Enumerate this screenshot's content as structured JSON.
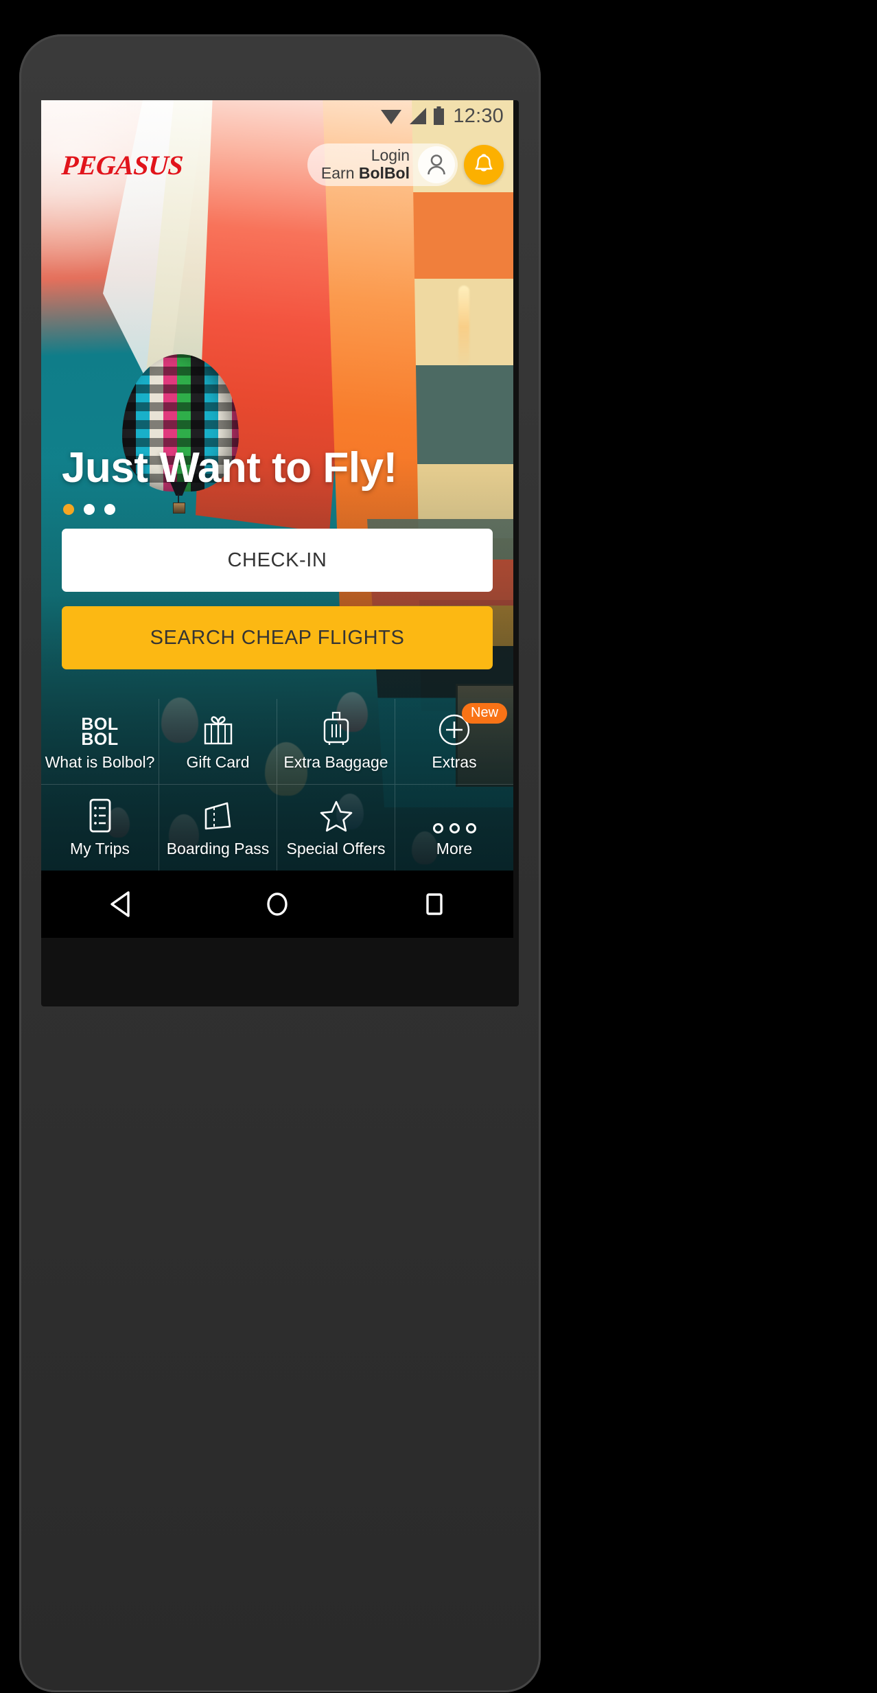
{
  "status_bar": {
    "time": "12:30",
    "icons": [
      "wifi-icon",
      "signal-icon",
      "battery-icon"
    ]
  },
  "header": {
    "brand": "PEGASUS",
    "brand_color": "#e1141b",
    "login_label": "Login",
    "earn_prefix": "Earn ",
    "earn_program": "BolBol",
    "avatar_icon": "user-icon",
    "bell_icon": "bell-icon",
    "bell_color": "#fcb000"
  },
  "hero": {
    "headline": "Just Want to Fly!",
    "dots_total": 3,
    "active_dot_index": 0,
    "active_dot_color": "#f5a623",
    "inactive_dot_color": "#ffffff"
  },
  "actions": {
    "checkin_label": "CHECK-IN",
    "checkin_bg": "#ffffff",
    "search_label": "SEARCH CHEAP FLIGHTS",
    "search_bg": "#fcb813"
  },
  "menu": {
    "items": [
      {
        "label": "What is Bolbol?",
        "icon": "bolbol-logo-icon",
        "badge": null
      },
      {
        "label": "Gift Card",
        "icon": "gift-icon",
        "badge": null
      },
      {
        "label": "Extra Baggage",
        "icon": "suitcase-icon",
        "badge": null
      },
      {
        "label": "Extras",
        "icon": "plus-circle-icon",
        "badge": "New"
      },
      {
        "label": "My Trips",
        "icon": "list-icon",
        "badge": null
      },
      {
        "label": "Boarding Pass",
        "icon": "boarding-pass-icon",
        "badge": null
      },
      {
        "label": "Special Offers",
        "icon": "star-icon",
        "badge": null
      },
      {
        "label": "More",
        "icon": "three-dots-icon",
        "badge": null
      }
    ],
    "bolbol_line1": "BOL",
    "bolbol_line2": "BOL",
    "badge_color": "#f97316"
  },
  "nav_bar": {
    "back_icon": "back-triangle-icon",
    "home_icon": "home-circle-icon",
    "recents_icon": "recents-square-icon"
  }
}
